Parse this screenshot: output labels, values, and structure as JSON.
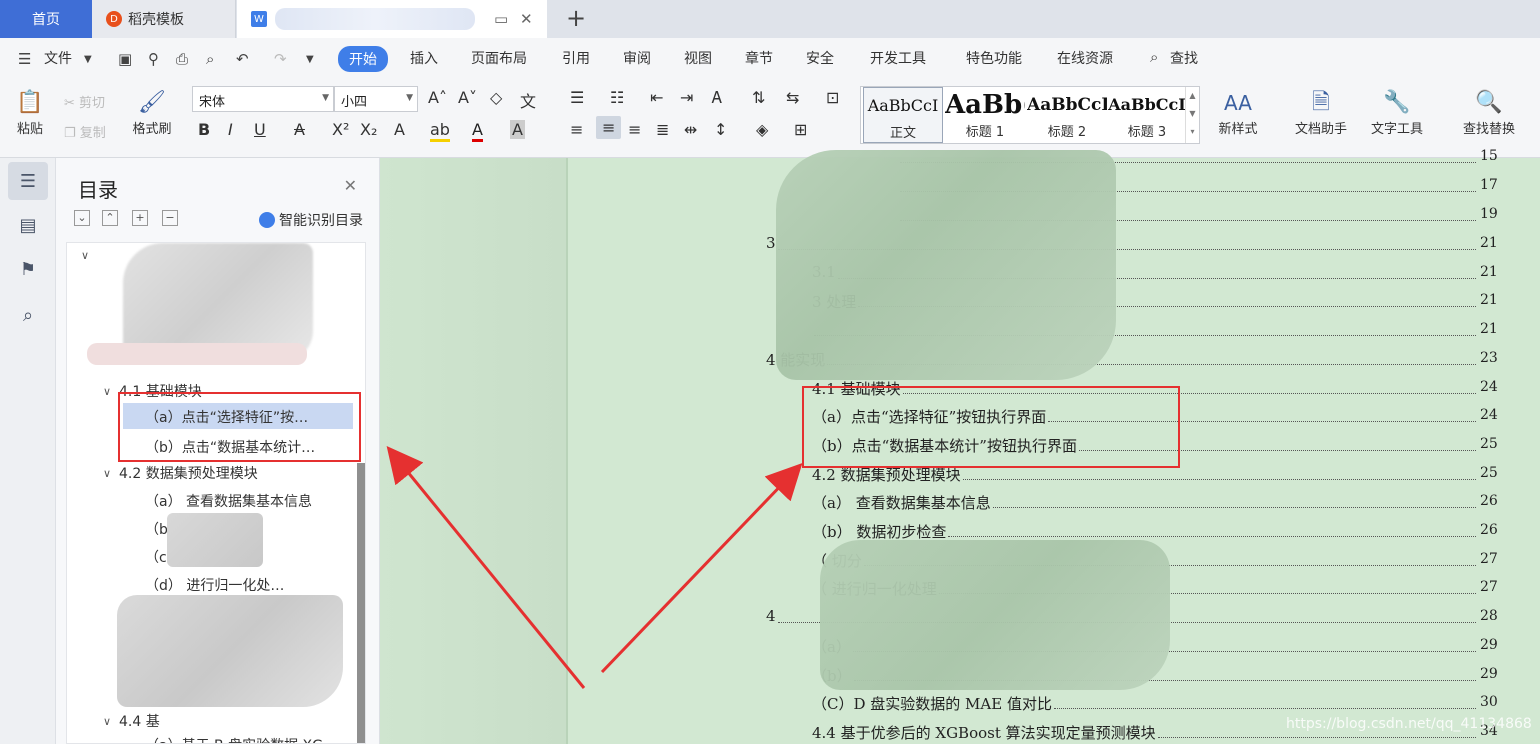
{
  "tabs": {
    "home": "首页",
    "template": "稻壳模板",
    "template_icon": "D",
    "doc_icon": "W",
    "add": "+"
  },
  "menu": {
    "file": "文件",
    "items": [
      "开始",
      "插入",
      "页面布局",
      "引用",
      "审阅",
      "视图",
      "章节",
      "安全",
      "开发工具",
      "特色功能",
      "在线资源",
      "查找"
    ]
  },
  "ribbon": {
    "paste": "粘贴",
    "cut": "剪切",
    "copy": "复制",
    "format_painter": "格式刷",
    "font_name": "宋体",
    "font_size": "小四",
    "styles": [
      {
        "preview": "AaBbCcI",
        "name": "正文"
      },
      {
        "preview": "AaBb(",
        "name": "标题 1"
      },
      {
        "preview": "AaBbCcI",
        "name": "标题 2"
      },
      {
        "preview": "AaBbCcI",
        "name": "标题 3"
      }
    ],
    "new_style": "新样式",
    "doc_assistant": "文档助手",
    "text_tools": "文字工具",
    "find_replace": "查找替换"
  },
  "nav": {
    "title": "目录",
    "smart_toc": "智能识别目录",
    "items": [
      {
        "label": "4.1 基础模块"
      },
      {
        "label": "（a）点击“选择特征”按…"
      },
      {
        "label": "（b）点击“数据基本统计…"
      },
      {
        "label": "4.2 数据集预处理模块"
      },
      {
        "label": "（a） 查看数据集基本信息"
      },
      {
        "label": "（b）"
      },
      {
        "label": "（c）"
      },
      {
        "label": "（d）  进行归一化处…"
      },
      {
        "label": "4.4 基"
      },
      {
        "label": "（a）基于 B 盘实验数据 XG…"
      }
    ]
  },
  "toc": [
    {
      "text": "3",
      "page": "21"
    },
    {
      "text": "3.1",
      "page": "21"
    },
    {
      "text": "3            处理",
      "page": "21"
    },
    {
      "text": "",
      "page": "21"
    },
    {
      "text": "4               能实现",
      "page": "23"
    },
    {
      "text": "4.1  基础模块",
      "page": "24"
    },
    {
      "text": "（a）点击“选择特征”按钮执行界面",
      "page": "24"
    },
    {
      "text": "（b）点击“数据基本统计”按钮执行界面",
      "page": "25"
    },
    {
      "text": "4.2  数据集预处理模块",
      "page": "25"
    },
    {
      "text": "（a）   查看数据集基本信息",
      "page": "26"
    },
    {
      "text": "（b）   数据初步检查",
      "page": "26"
    },
    {
      "text": "（          切分",
      "page": "27"
    },
    {
      "text": "（          进行归一化处理",
      "page": "27"
    },
    {
      "text": "4",
      "page": "28"
    },
    {
      "text": "（a）",
      "page": "29"
    },
    {
      "text": "（b）",
      "page": "29"
    },
    {
      "text": "（C）D 盘实验数据的 MAE 值对比",
      "page": "30"
    },
    {
      "text": "4.4  基于优参后的 XGBoost 算法实现定量预测模块",
      "page": "34"
    }
  ],
  "top_pages": [
    "15",
    "17",
    "19"
  ],
  "watermark": "https://blog.csdn.net/qq_41134868"
}
